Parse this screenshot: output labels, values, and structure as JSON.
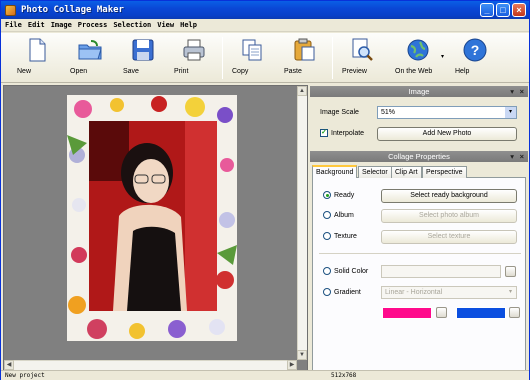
{
  "app": {
    "title": "Photo Collage Maker"
  },
  "menu": [
    "File",
    "Edit",
    "Image",
    "Process",
    "Selection",
    "View",
    "Help"
  ],
  "toolbar": [
    {
      "label": "New",
      "icon": "new-document-icon"
    },
    {
      "label": "Open",
      "icon": "open-folder-icon"
    },
    {
      "label": "Save",
      "icon": "save-disk-icon"
    },
    {
      "label": "Print",
      "icon": "printer-icon"
    },
    {
      "label": "Copy",
      "icon": "copy-icon"
    },
    {
      "label": "Paste",
      "icon": "paste-clipboard-icon"
    },
    {
      "label": "Preview",
      "icon": "preview-magnifier-icon"
    },
    {
      "label": "On the Web",
      "icon": "globe-icon"
    },
    {
      "label": "Help",
      "icon": "help-question-icon"
    }
  ],
  "image_panel": {
    "title": "Image",
    "scale_label": "Image Scale",
    "scale_value": "51%",
    "interpolate_label": "Interpolate",
    "interpolate_checked": true,
    "add_photo_label": "Add New Photo"
  },
  "collage_panel": {
    "title": "Collage Properties",
    "tabs": [
      "Background",
      "Selector",
      "Clip Art",
      "Perspective"
    ],
    "active_tab": "Background",
    "options": {
      "ready": "Ready",
      "ready_button": "Select ready background",
      "album": "Album",
      "album_button": "Select photo album",
      "texture": "Texture",
      "texture_button": "Select texture",
      "solid_color": "Solid Color",
      "gradient": "Gradient",
      "gradient_value": "Linear - Horizontal"
    },
    "gradient_colors": [
      "#ff0a8c",
      "#0b4fe0"
    ]
  },
  "status": {
    "left": "New project",
    "size": "512x768"
  },
  "colors": {
    "titlebar": "#0a48d6",
    "canvas": "#808080",
    "photo_bg": "#c52222"
  }
}
